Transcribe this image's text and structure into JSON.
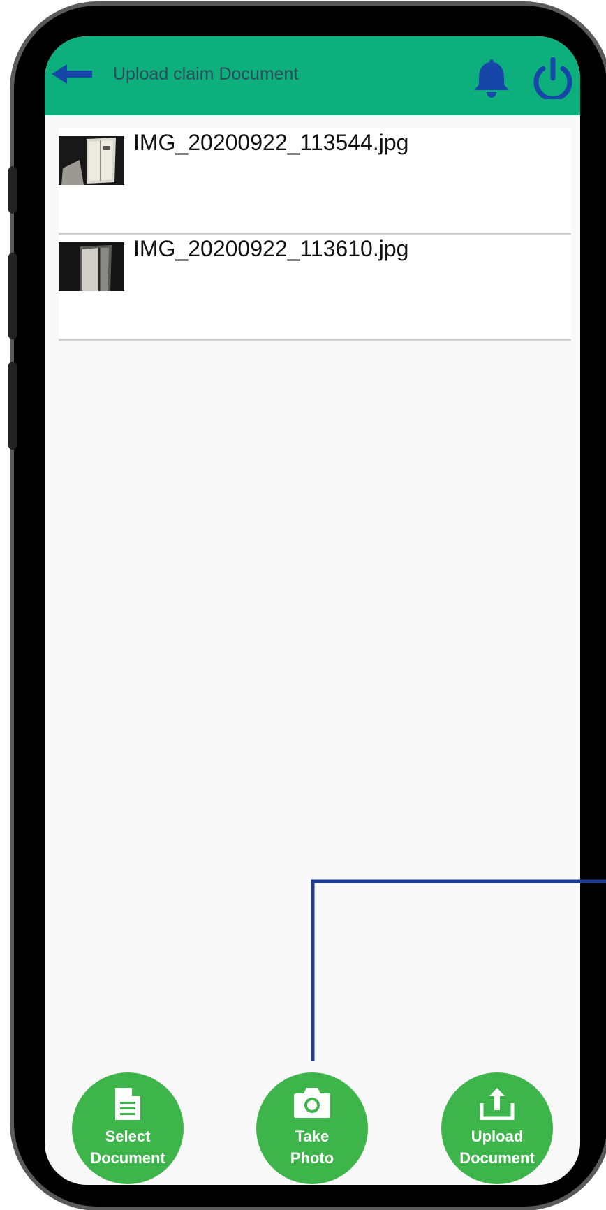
{
  "header": {
    "title": "Upload claim Document",
    "back_icon": "arrow-left-icon",
    "notification_icon": "bell-icon",
    "power_icon": "power-icon",
    "bar_color": "#0db07d",
    "icon_color": "#1646a8"
  },
  "files": [
    {
      "name": "IMG_20200922_113544.jpg"
    },
    {
      "name": "IMG_20200922_113610.jpg"
    }
  ],
  "actions": {
    "select_label": "Select\nDocument",
    "photo_label": "Take\nPhoto",
    "upload_label": "Upload\nDocument",
    "button_color": "#3db54a"
  }
}
